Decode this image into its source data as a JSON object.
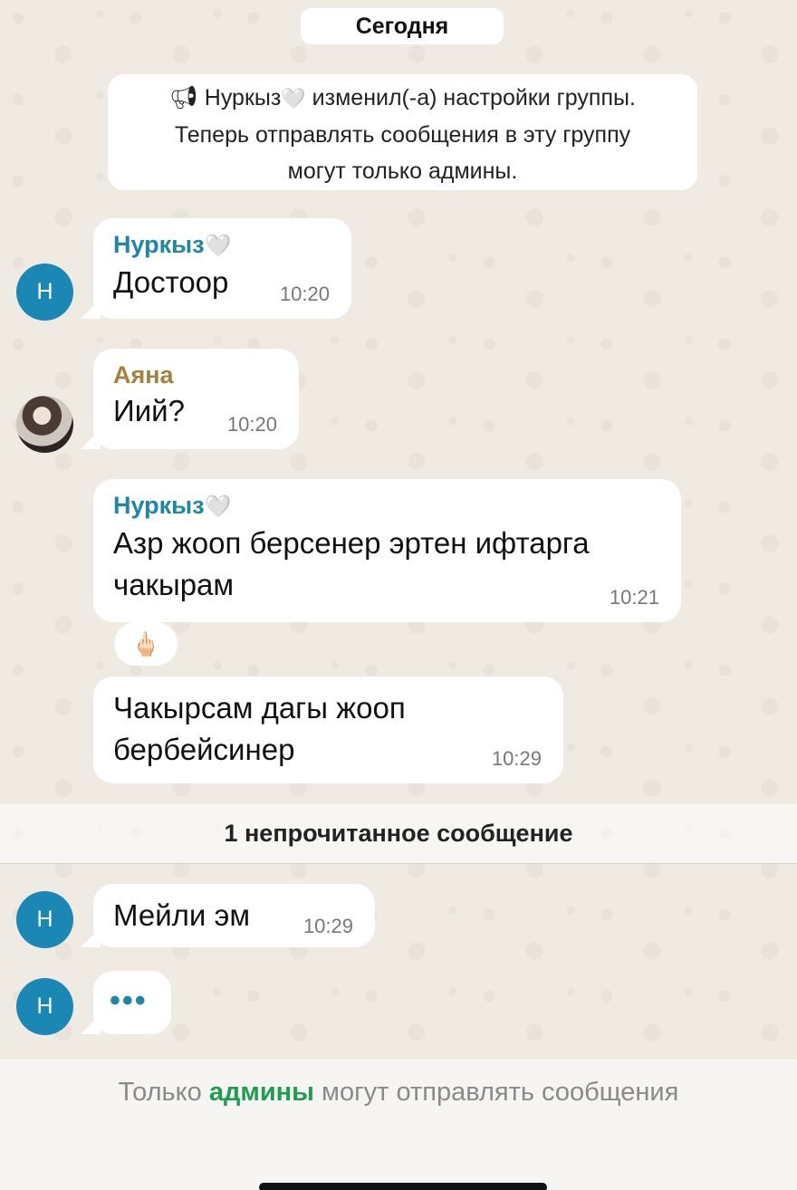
{
  "date_label": "Сегодня",
  "system_message": {
    "icon": "megaphone-icon",
    "author": "Нуркыз",
    "heart": "🤍",
    "line1_rest": " изменил(-а) настройки группы.",
    "line2": "Теперь отправлять сообщения в эту группу",
    "line3": "могут только админы."
  },
  "messages": [
    {
      "sender": "Нуркыз",
      "heart": "🤍",
      "text": "Достоор",
      "time": "10:20",
      "avatar": "Н"
    },
    {
      "sender": "Аяна",
      "text": "Иий?",
      "time": "10:20",
      "avatar": "photo"
    },
    {
      "sender": "Нуркыз",
      "heart": "🤍",
      "text_line1": "Азр жооп берсенер эртен ифтарга",
      "text_line2": "чакырам",
      "time": "10:21",
      "reaction": "🖕🏻"
    },
    {
      "text_line1": "Чакырсам дагы жооп",
      "text_line2": "бербейсинер",
      "time": "10:29"
    },
    {
      "text": "Мейли эм",
      "time": "10:29",
      "avatar": "Н"
    },
    {
      "typing": "•••",
      "avatar": "Н"
    }
  ],
  "unread_label": "1 непрочитанное сообщение",
  "footer": {
    "before": "Только ",
    "accent": "админы",
    "after": " могут отправлять сообщения",
    "accent_color": "#1f9e4f"
  },
  "colors": {
    "sender_teal": "#1e87a8",
    "sender_gold": "#a3823b",
    "avatar_blue": "#1b87b4",
    "wallpaper": "#efeae2"
  }
}
